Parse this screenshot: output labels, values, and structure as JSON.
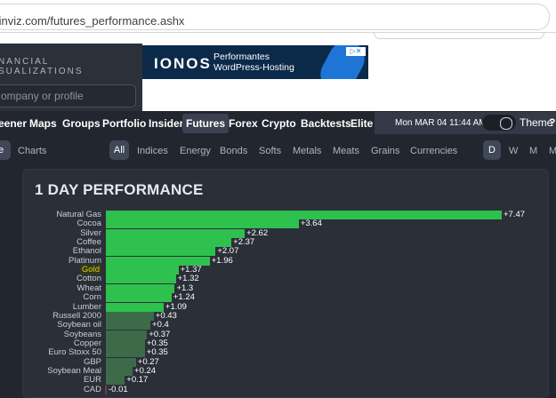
{
  "browser": {
    "url": "finviz.com/futures_performance.ashx"
  },
  "header": {
    "logo_line1": "NANCIAL",
    "logo_line2": "SUALIZATIONS",
    "search_placeholder": "ompany or profile",
    "ad": {
      "brand": "IONOS",
      "text": "Performantes WordPress-Hosting",
      "icons": "▷✕"
    }
  },
  "nav": {
    "items": [
      "eener",
      "Maps",
      "Groups",
      "Portfolio",
      "Insider",
      "Futures",
      "Forex",
      "Crypto",
      "Backtests",
      "Elite"
    ],
    "active": "Futures",
    "date": "Mon MAR 04 11:44 AM",
    "theme_label": "Theme",
    "help": "?"
  },
  "subnav": {
    "left_tab": "e",
    "charts": "Charts",
    "filters": [
      "All",
      "Indices",
      "Energy",
      "Bonds",
      "Softs",
      "Metals",
      "Meats",
      "Grains",
      "Currencies"
    ],
    "selected_filter": "All",
    "periods": [
      "D",
      "W",
      "M",
      "M"
    ],
    "selected_period": "D"
  },
  "colors": {
    "positive_strong": "#2fc14e",
    "positive_weak": "#3d6b4a",
    "negative": "#7d3a3a"
  },
  "chart_data": {
    "type": "bar",
    "orientation": "horizontal",
    "title": "1 DAY PERFORMANCE",
    "categories": [
      "Natural Gas",
      "Cocoa",
      "Silver",
      "Coffee",
      "Ethanol",
      "Platinum",
      "Gold",
      "Cotton",
      "Wheat",
      "Corn",
      "Lumber",
      "Russell 2000",
      "Soybean oil",
      "Soybeans",
      "Copper",
      "Euro Stoxx 50",
      "GBP",
      "Soybean Meal",
      "EUR",
      "CAD"
    ],
    "values": [
      7.47,
      3.64,
      2.62,
      2.37,
      2.07,
      1.96,
      1.37,
      1.32,
      1.3,
      1.24,
      1.09,
      0.43,
      0.4,
      0.37,
      0.35,
      0.35,
      0.27,
      0.24,
      0.17,
      -0.01
    ],
    "labels": [
      "+7.47",
      "+3.64",
      "+2.62",
      "+2.37",
      "+2.07",
      "+1.96",
      "+1.37",
      "+1.32",
      "+1.3",
      "+1.24",
      "+1.09",
      "+0.43",
      "+0.4",
      "+0.37",
      "+0.35",
      "+0.35",
      "+0.27",
      "+0.24",
      "+0.17",
      "-0.01"
    ],
    "highlighted": "Gold"
  }
}
